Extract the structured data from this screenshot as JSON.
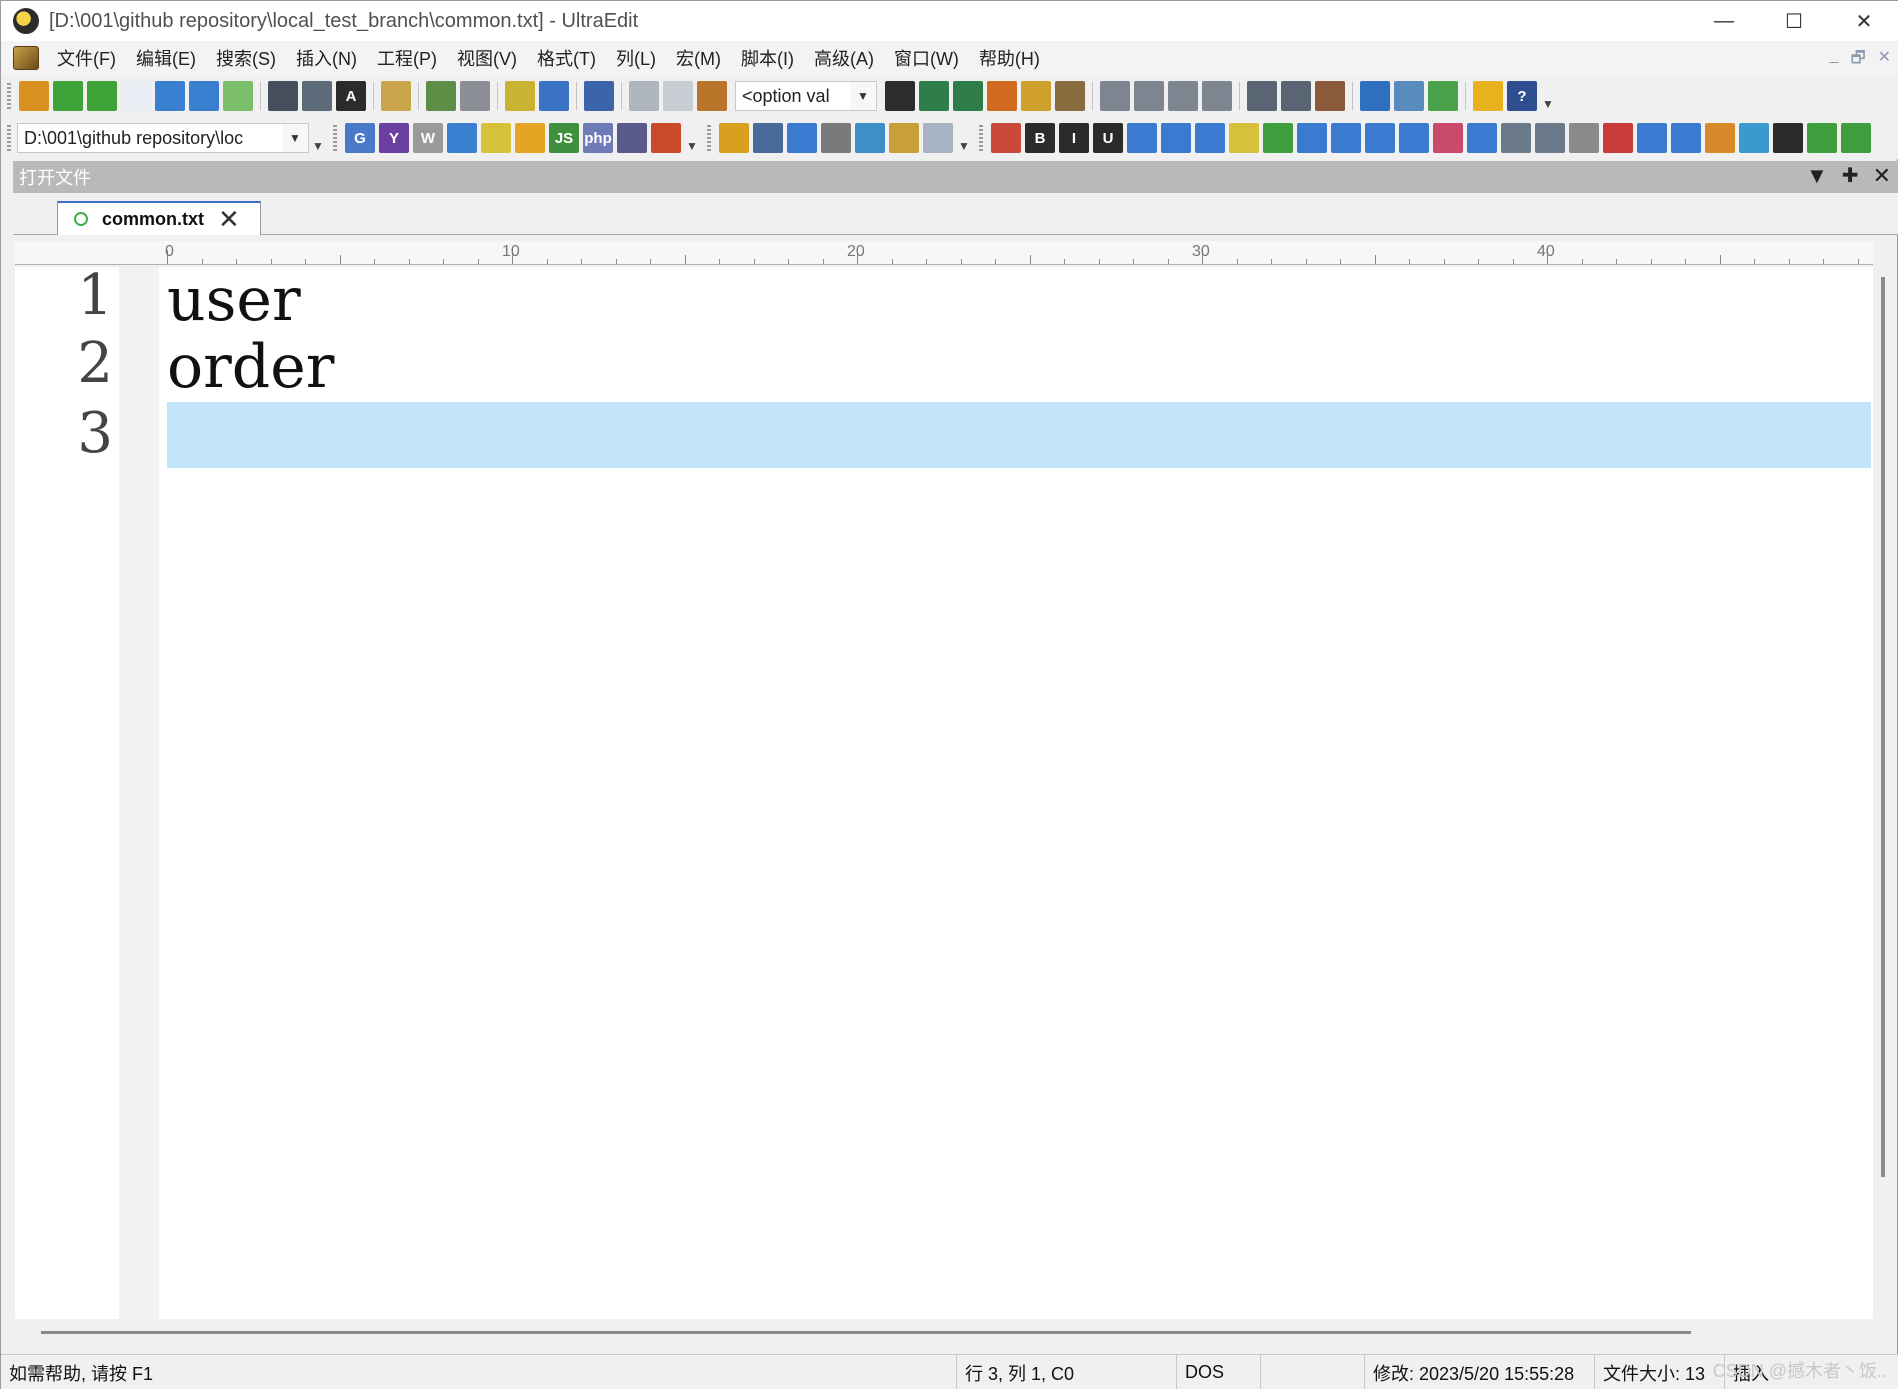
{
  "window": {
    "title": "[D:\\001\\github repository\\local_test_branch\\common.txt] - UltraEdit",
    "controls": {
      "minimize": "—",
      "maximize": "☐",
      "close": "✕"
    }
  },
  "menu": {
    "items": [
      "文件(F)",
      "编辑(E)",
      "搜索(S)",
      "插入(N)",
      "工程(P)",
      "视图(V)",
      "格式(T)",
      "列(L)",
      "宏(M)",
      "脚本(I)",
      "高级(A)",
      "窗口(W)",
      "帮助(H)"
    ],
    "mdi_controls": {
      "minimize": "_",
      "restore": "🗗",
      "close": "✕"
    }
  },
  "toolbar": {
    "option_combo": "<option val",
    "path_combo": "D:\\001\\github repository\\loc",
    "buttons_row1": [
      {
        "icon": "open-folder-icon",
        "color": "#d8901e"
      },
      {
        "icon": "back-arrow-icon",
        "color": "#3ea336"
      },
      {
        "icon": "forward-arrow-icon",
        "color": "#3ea336"
      },
      {
        "icon": "new-file-icon",
        "color": "#e9eef4"
      },
      {
        "icon": "open-file-icon",
        "color": "#3b7fd0"
      },
      {
        "icon": "close-file-icon",
        "color": "#3b7fd0"
      },
      {
        "icon": "save-icon",
        "color": "#7bbf6a"
      },
      {
        "icon": "print-icon",
        "color": "#46505c"
      },
      {
        "icon": "print-preview-icon",
        "color": "#5d6b7a"
      },
      {
        "icon": "font-icon",
        "color": "#2b2b2b",
        "text": "A"
      },
      {
        "icon": "word-wrap-icon",
        "color": "#c9a44a"
      },
      {
        "icon": "line-numbers-icon",
        "color": "#5c8e45"
      },
      {
        "icon": "hex-edit-icon",
        "color": "#8b8f95"
      },
      {
        "icon": "column-mode-icon",
        "color": "#c8b432"
      },
      {
        "icon": "document-view-icon",
        "color": "#3a73c5"
      },
      {
        "icon": "browser-icon",
        "color": "#3b65a8"
      },
      {
        "icon": "cut-icon",
        "color": "#b0b6bd"
      },
      {
        "icon": "copy-icon",
        "color": "#c9ced4"
      },
      {
        "icon": "paste-icon",
        "color": "#b8752a"
      }
    ],
    "buttons_row1b": [
      {
        "icon": "find-icon",
        "color": "#2d2d2d"
      },
      {
        "icon": "find-prev-icon",
        "color": "#2e7d4a"
      },
      {
        "icon": "find-next-icon",
        "color": "#2e7d4a"
      },
      {
        "icon": "replace-icon",
        "color": "#d06a1e"
      },
      {
        "icon": "find-in-files-icon",
        "color": "#d0a02e"
      },
      {
        "icon": "replace-in-files-icon",
        "color": "#8a6b3e"
      },
      {
        "icon": "align-left-icon",
        "color": "#7c8590"
      },
      {
        "icon": "align-center-icon",
        "color": "#7c8590"
      },
      {
        "icon": "align-right-icon",
        "color": "#7c8590"
      },
      {
        "icon": "justify-icon",
        "color": "#7c8590"
      },
      {
        "icon": "split-window-icon",
        "color": "#5a6573"
      },
      {
        "icon": "tile-window-icon",
        "color": "#5a6573"
      },
      {
        "icon": "cascade-window-icon",
        "color": "#8a5a3a"
      },
      {
        "icon": "web-icon",
        "color": "#2f6fbf"
      },
      {
        "icon": "screenshot-icon",
        "color": "#5a8bbf"
      },
      {
        "icon": "refresh-icon",
        "color": "#4aa34a"
      },
      {
        "icon": "tip-bulb-icon",
        "color": "#e8b21e"
      },
      {
        "icon": "help-icon",
        "color": "#2d4f8f",
        "text": "?"
      }
    ],
    "buttons_row2a": [
      {
        "icon": "google-icon",
        "color": "#4a79c9",
        "text": "G"
      },
      {
        "icon": "yahoo-icon",
        "color": "#6b3fa0",
        "text": "Y"
      },
      {
        "icon": "wikipedia-icon",
        "color": "#9a9a9a",
        "text": "W"
      },
      {
        "icon": "search-web-icon",
        "color": "#3b7fd0"
      },
      {
        "icon": "bulb-search-icon",
        "color": "#d8c13a"
      },
      {
        "icon": "folder-search-icon",
        "color": "#e6a425"
      },
      {
        "icon": "js-icon",
        "color": "#3e8f3e",
        "text": "JS"
      },
      {
        "icon": "php-icon",
        "color": "#6f7bb6",
        "text": "php"
      },
      {
        "icon": "css-icon",
        "color": "#5a5a8a"
      },
      {
        "icon": "windows-icon",
        "color": "#c94a2a"
      }
    ],
    "buttons_row2b": [
      {
        "icon": "chrome-icon",
        "color": "#d9a020"
      },
      {
        "icon": "copy-path-icon",
        "color": "#4a6a9a"
      },
      {
        "icon": "ftp-icon",
        "color": "#3a7ad0"
      },
      {
        "icon": "id-icon",
        "color": "#7a7a7a"
      },
      {
        "icon": "number-icon",
        "color": "#3e8ec8"
      },
      {
        "icon": "pen-icon",
        "color": "#c8a03a"
      },
      {
        "icon": "doc-link-icon",
        "color": "#a8b4c4"
      }
    ],
    "buttons_row2c": [
      {
        "icon": "list-icon",
        "color": "#c94a3a"
      },
      {
        "icon": "bold-icon",
        "color": "#2b2b2b",
        "text": "B"
      },
      {
        "icon": "italic-icon",
        "color": "#2b2b2b",
        "text": "I"
      },
      {
        "icon": "underline-icon",
        "color": "#2b2b2b",
        "text": "U"
      },
      {
        "icon": "html-table-icon",
        "color": "#3a7ad0"
      },
      {
        "icon": "html-row-icon",
        "color": "#3a7ad0"
      },
      {
        "icon": "html-cell-icon",
        "color": "#3a7ad0"
      },
      {
        "icon": "color-grid-icon",
        "color": "#d8c13a"
      },
      {
        "icon": "palette-icon",
        "color": "#3e9e3e"
      },
      {
        "icon": "heading1-icon",
        "color": "#3a7ad0"
      },
      {
        "icon": "heading2-icon",
        "color": "#3a7ad0"
      },
      {
        "icon": "heading3-icon",
        "color": "#3a7ad0"
      },
      {
        "icon": "heading4-icon",
        "color": "#3a7ad0"
      },
      {
        "icon": "form-icon",
        "color": "#c94a6a"
      },
      {
        "icon": "button-icon",
        "color": "#3a7ad0"
      },
      {
        "icon": "text-field-icon",
        "color": "#6a7a8a"
      },
      {
        "icon": "textarea-icon",
        "color": "#6a7a8a"
      },
      {
        "icon": "password-icon",
        "color": "#8a8a8a"
      },
      {
        "icon": "reset-icon",
        "color": "#c93a3a"
      },
      {
        "icon": "checkbox-icon",
        "color": "#3a7ad0"
      },
      {
        "icon": "radio-icon",
        "color": "#3a7ad0"
      },
      {
        "icon": "image-icon",
        "color": "#d88a2a"
      },
      {
        "icon": "image-map-icon",
        "color": "#3a9ad0"
      },
      {
        "icon": "anchor-icon",
        "color": "#2b2b2b"
      },
      {
        "icon": "comment-icon",
        "color": "#3e9e3e"
      },
      {
        "icon": "special-char-icon",
        "color": "#3e9e3e"
      }
    ]
  },
  "panel": {
    "title": "打开文件",
    "controls": {
      "dropdown": "▼",
      "pin": "📌",
      "close": "✕"
    }
  },
  "tabs": [
    {
      "label": "common.txt",
      "close": "✕"
    }
  ],
  "ruler": {
    "labels": [
      "0",
      "10",
      "20",
      "30",
      "40"
    ]
  },
  "editor": {
    "lines": [
      {
        "number": "1",
        "text": "user"
      },
      {
        "number": "2",
        "text": "order"
      },
      {
        "number": "3",
        "text": ""
      }
    ],
    "current_line_color": "#c3e5fb"
  },
  "status": {
    "help": "如需帮助, 请按 F1",
    "position": "行 3, 列 1, C0",
    "line_ending": "DOS",
    "modified": "修改: 2023/5/20 15:55:28",
    "file_size": "文件大小: 13",
    "insert_mode": "插入",
    "watermark": "CSDN @撼木者丶饭.."
  }
}
